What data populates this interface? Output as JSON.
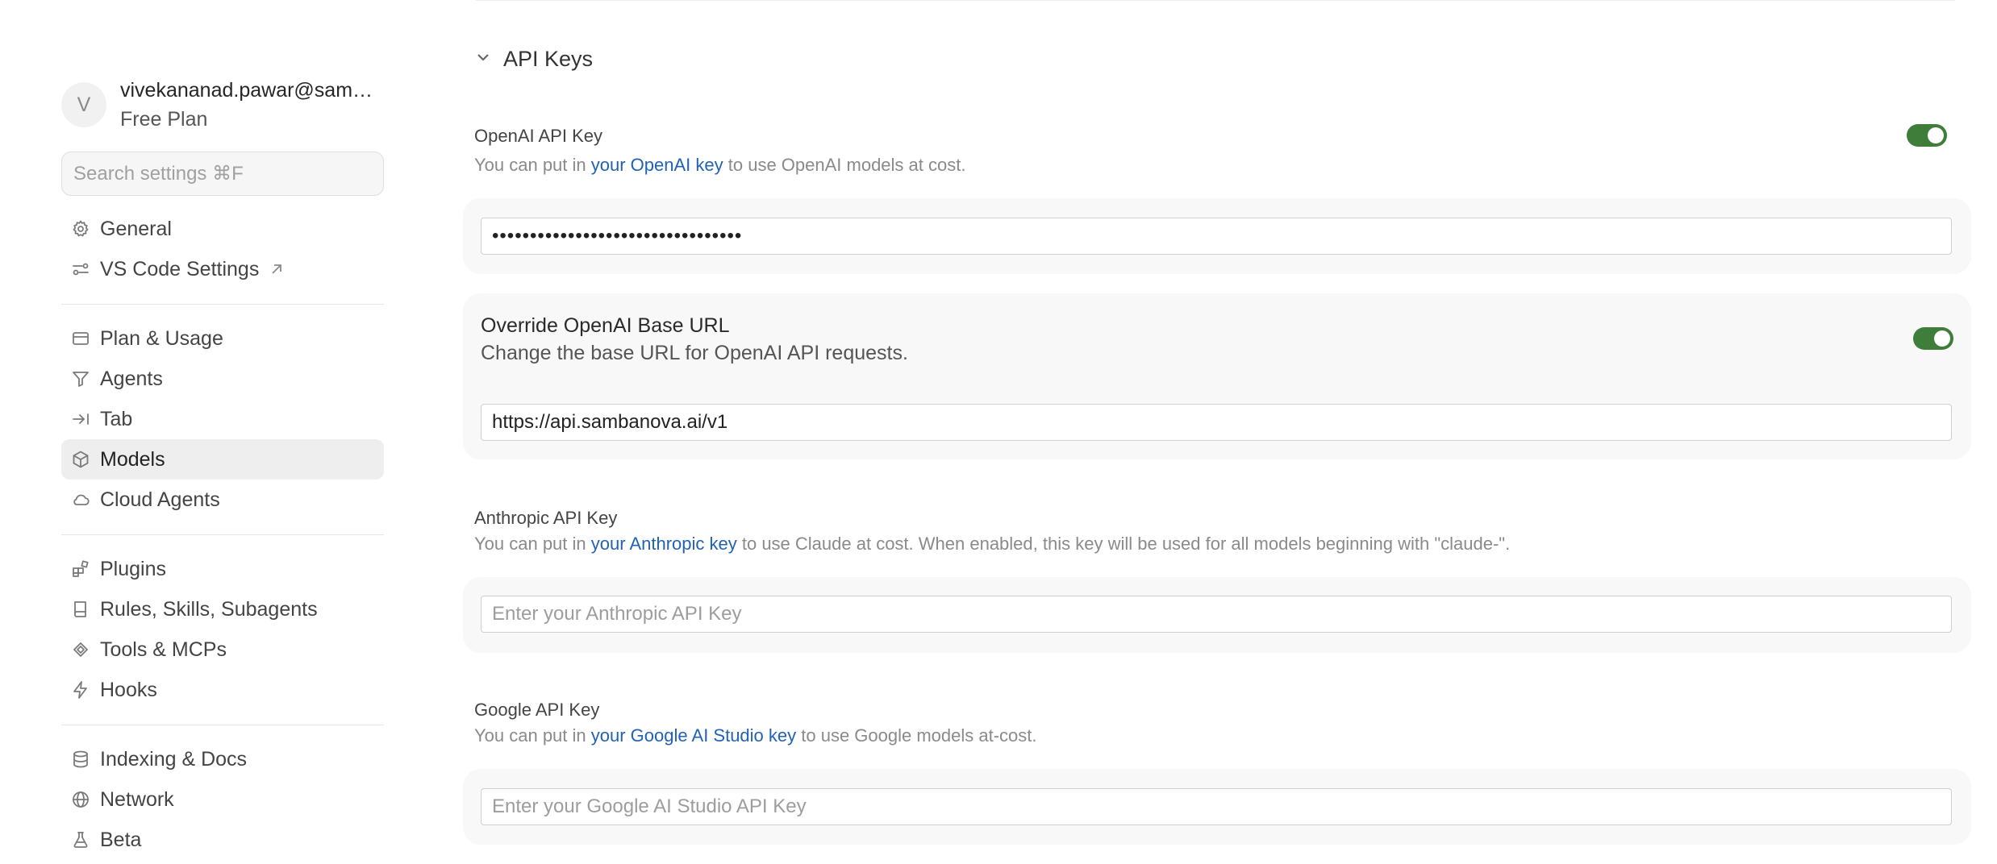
{
  "sidebar": {
    "avatar_initial": "V",
    "email": "vivekananad.pawar@sambanova.ai",
    "plan": "Free Plan",
    "search_placeholder": "Search settings ⌘F",
    "groups": [
      [
        {
          "label": "General",
          "icon": "gear-icon"
        },
        {
          "label": "VS Code Settings",
          "icon": "sliders-icon",
          "external": true
        }
      ],
      [
        {
          "label": "Plan & Usage",
          "icon": "billing-icon"
        },
        {
          "label": "Agents",
          "icon": "agents-icon"
        },
        {
          "label": "Tab",
          "icon": "tab-icon"
        },
        {
          "label": "Models",
          "icon": "cube-icon",
          "active": true
        },
        {
          "label": "Cloud Agents",
          "icon": "cloud-icon"
        }
      ],
      [
        {
          "label": "Plugins",
          "icon": "plugins-icon"
        },
        {
          "label": "Rules, Skills, Subagents",
          "icon": "book-icon"
        },
        {
          "label": "Tools & MCPs",
          "icon": "tools-icon"
        },
        {
          "label": "Hooks",
          "icon": "lightning-icon"
        }
      ],
      [
        {
          "label": "Indexing & Docs",
          "icon": "database-icon"
        },
        {
          "label": "Network",
          "icon": "globe-icon"
        },
        {
          "label": "Beta",
          "icon": "flask-icon"
        }
      ]
    ]
  },
  "main": {
    "section_title": "API Keys",
    "openai": {
      "label": "OpenAI API Key",
      "desc_prefix": "You can put in ",
      "desc_link": "your OpenAI key",
      "desc_suffix": " to use OpenAI models at cost.",
      "value": "sk-samba-nova-override-key-xxxxxx",
      "enabled": true
    },
    "override": {
      "title": "Override OpenAI Base URL",
      "desc": "Change the base URL for OpenAI API requests.",
      "value": "https://api.sambanova.ai/v1",
      "enabled": true
    },
    "anthropic": {
      "label": "Anthropic API Key",
      "desc_prefix": "You can put in ",
      "desc_link": "your Anthropic key",
      "desc_suffix": " to use Claude at cost. When enabled, this key will be used for all models beginning with \"claude-\".",
      "placeholder": "Enter your Anthropic API Key"
    },
    "google": {
      "label": "Google API Key",
      "desc_prefix": "You can put in ",
      "desc_link": "your Google AI Studio key",
      "desc_suffix": " to use Google models at-cost.",
      "placeholder": "Enter your Google AI Studio API Key"
    },
    "toggle_color": "#3f7d3a",
    "link_color": "#2162b6"
  }
}
